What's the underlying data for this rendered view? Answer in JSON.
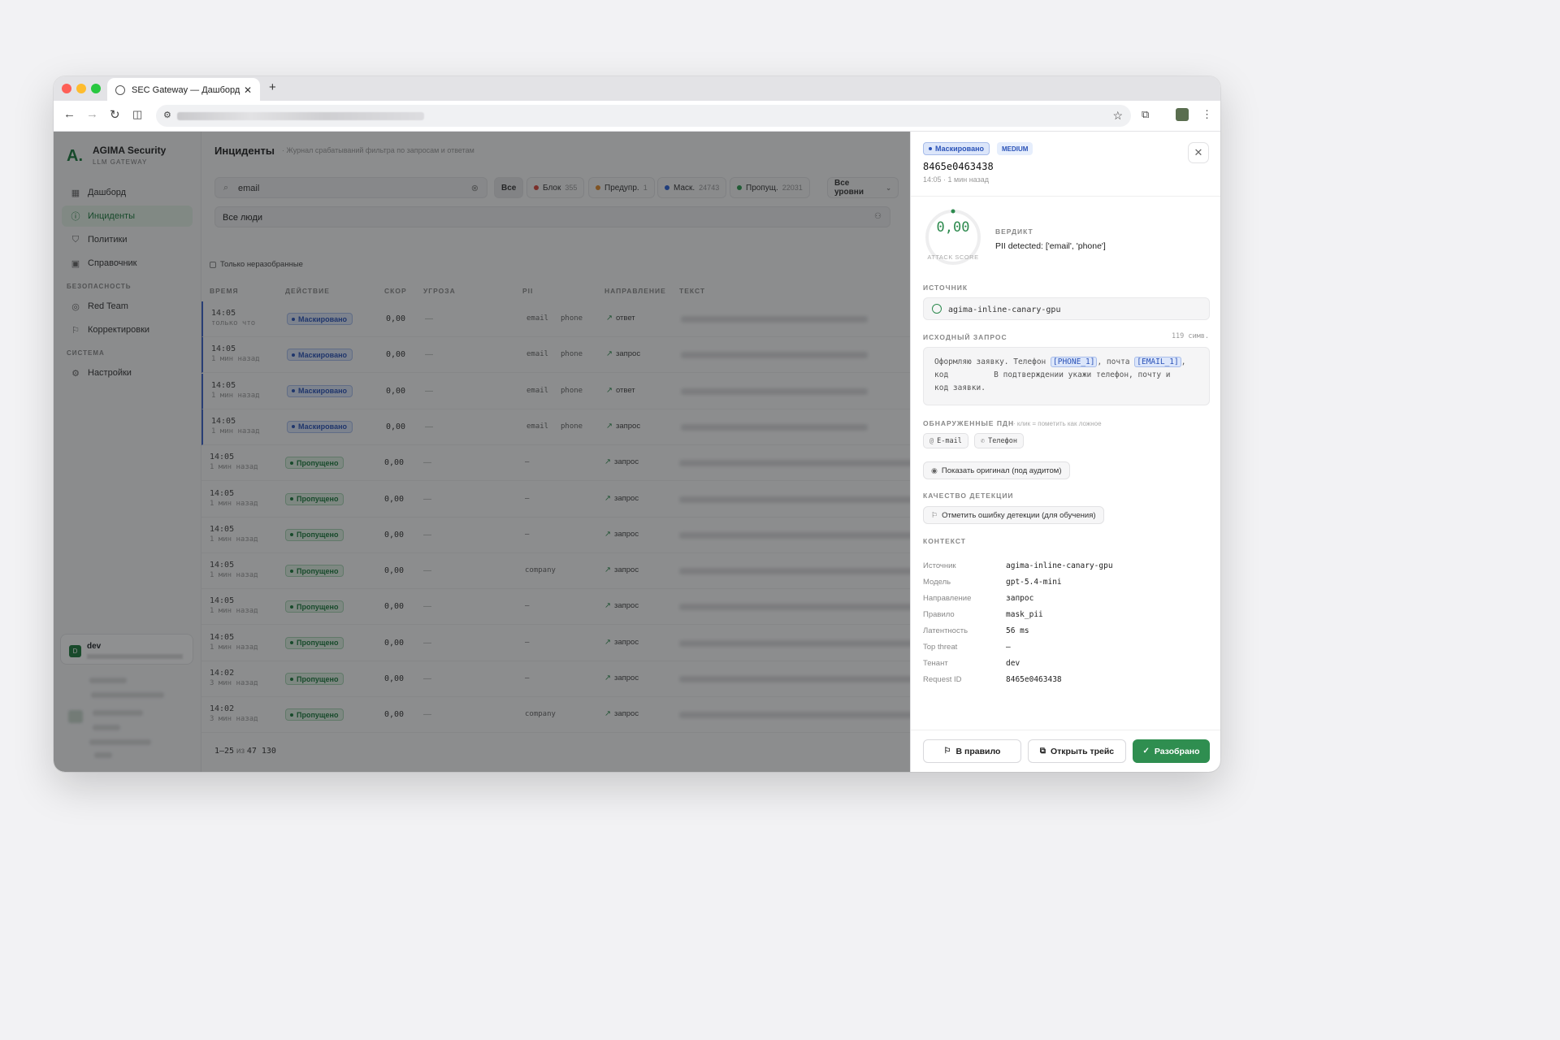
{
  "browser": {
    "tab_title": "SEC Gateway — Дашборд",
    "new_tab": "+",
    "close_tab": "✕"
  },
  "sidebar": {
    "brand": "AGIMA Security",
    "brand_sub": "LLM GATEWAY",
    "items": [
      {
        "label": "Дашборд",
        "icon": "grid-icon",
        "glyph": "▦"
      },
      {
        "label": "Инциденты",
        "icon": "alert-circle-icon",
        "glyph": "ⓘ",
        "active": true
      },
      {
        "label": "Политики",
        "icon": "shield-icon",
        "glyph": "⛉"
      },
      {
        "label": "Справочник",
        "icon": "book-icon",
        "glyph": "▣"
      }
    ],
    "section_security": "БЕЗОПАСНОСТЬ",
    "security_items": [
      {
        "label": "Red Team",
        "icon": "target-icon",
        "glyph": "◎"
      },
      {
        "label": "Корректировки",
        "icon": "flag-icon",
        "glyph": "⚐"
      }
    ],
    "section_system": "СИСТЕМА",
    "system_items": [
      {
        "label": "Настройки",
        "icon": "gear-icon",
        "glyph": "⚙"
      }
    ],
    "user": {
      "initial": "D",
      "name": "dev"
    }
  },
  "main": {
    "title": "Инциденты",
    "subtitle": "· Журнал срабатываний фильтра по запросам и ответам",
    "search_value": "email",
    "filters": [
      {
        "label": "Все",
        "count": "",
        "color": ""
      },
      {
        "label": "Блок",
        "count": "355",
        "color": "#d9453b"
      },
      {
        "label": "Предупр.",
        "count": "1",
        "color": "#e08a2c"
      },
      {
        "label": "Маск.",
        "count": "24743",
        "color": "#2b63d6"
      },
      {
        "label": "Пропущ.",
        "count": "22031",
        "color": "#2d9a50"
      }
    ],
    "level_select": "Все уровни",
    "people_select": "Все люди",
    "only_unsorted": "Только неразобранные",
    "columns": [
      "ВРЕМЯ",
      "ДЕЙСТВИЕ",
      "СКОР",
      "УГРОЗА",
      "PII",
      "НАПРАВЛЕНИЕ",
      "ТЕКСТ"
    ],
    "rows": [
      {
        "time": "14:05",
        "ago": "только что",
        "action": "Маскировано",
        "kind": "mask",
        "score": "0,00",
        "threat": "—",
        "pii": "email",
        "pii2": "phone",
        "dir": "ответ"
      },
      {
        "time": "14:05",
        "ago": "1 мин назад",
        "action": "Маскировано",
        "kind": "mask",
        "score": "0,00",
        "threat": "—",
        "pii": "email",
        "pii2": "phone",
        "dir": "запрос"
      },
      {
        "time": "14:05",
        "ago": "1 мин назад",
        "action": "Маскировано",
        "kind": "mask",
        "score": "0,00",
        "threat": "—",
        "pii": "email",
        "pii2": "phone",
        "dir": "ответ"
      },
      {
        "time": "14:05",
        "ago": "1 мин назад",
        "action": "Маскировано",
        "kind": "mask",
        "score": "0,00",
        "threat": "—",
        "pii": "email",
        "pii2": "phone",
        "dir": "запрос"
      },
      {
        "time": "14:05",
        "ago": "1 мин назад",
        "action": "Пропущено",
        "kind": "pass",
        "score": "0,00",
        "threat": "—",
        "pii": "—",
        "pii2": "",
        "dir": "запрос"
      },
      {
        "time": "14:05",
        "ago": "1 мин назад",
        "action": "Пропущено",
        "kind": "pass",
        "score": "0,00",
        "threat": "—",
        "pii": "—",
        "pii2": "",
        "dir": "запрос"
      },
      {
        "time": "14:05",
        "ago": "1 мин назад",
        "action": "Пропущено",
        "kind": "pass",
        "score": "0,00",
        "threat": "—",
        "pii": "—",
        "pii2": "",
        "dir": "запрос"
      },
      {
        "time": "14:05",
        "ago": "1 мин назад",
        "action": "Пропущено",
        "kind": "pass",
        "score": "0,00",
        "threat": "—",
        "pii": "company",
        "pii2": "",
        "dir": "запрос"
      },
      {
        "time": "14:05",
        "ago": "1 мин назад",
        "action": "Пропущено",
        "kind": "pass",
        "score": "0,00",
        "threat": "—",
        "pii": "—",
        "pii2": "",
        "dir": "запрос"
      },
      {
        "time": "14:05",
        "ago": "1 мин назад",
        "action": "Пропущено",
        "kind": "pass",
        "score": "0,00",
        "threat": "—",
        "pii": "—",
        "pii2": "",
        "dir": "запрос"
      },
      {
        "time": "14:02",
        "ago": "3 мин назад",
        "action": "Пропущено",
        "kind": "pass",
        "score": "0,00",
        "threat": "—",
        "pii": "—",
        "pii2": "",
        "dir": "запрос"
      },
      {
        "time": "14:02",
        "ago": "3 мин назад",
        "action": "Пропущено",
        "kind": "pass",
        "score": "0,00",
        "threat": "—",
        "pii": "company",
        "pii2": "",
        "dir": "запрос"
      }
    ],
    "pager": {
      "range": "1–25",
      "of": "из",
      "total": "47 130"
    }
  },
  "drawer": {
    "status_badge": "Маскировано",
    "level_badge": "MEDIUM",
    "request_id": "8465e0463438",
    "time": "14:05 · 1 мин назад",
    "score": "0,00",
    "score_value": 0,
    "score_label": "ATTACK SCORE",
    "verdict_label": "ВЕРДИКТ",
    "verdict": "PII detected: ['email', 'phone']",
    "source_label": "ИСТОЧНИК",
    "source": "agima-inline-canary-gpu",
    "request_label": "ИСХОДНЫЙ ЗАПРОС",
    "request_chars": "119 симв.",
    "request_parts": {
      "p1": "Оформляю заявку. Телефон ",
      "tok1": "[PHONE_1]",
      "p2": ", почта ",
      "tok2": "[EMAIL_1]",
      "p3": ",",
      "line2a": "код",
      "line2b": "В подтверждении укажи телефон, почту и",
      "line3": "код заявки."
    },
    "pii_label": "ОБНАРУЖЕННЫЕ ПДН",
    "pii_hint": "· клик = пометить как ложное",
    "pii_items": [
      "E-mail",
      "Телефон"
    ],
    "show_original": "Показать оригинал (под аудитом)",
    "quality_label": "КАЧЕСТВО ДЕТЕКЦИИ",
    "report_error": "Отметить ошибку детекции (для обучения)",
    "context_label": "КОНТЕКСТ",
    "context": [
      {
        "k": "Источник",
        "v": "agima-inline-canary-gpu"
      },
      {
        "k": "Модель",
        "v": "gpt-5.4-mini"
      },
      {
        "k": "Направление",
        "v": "запрос"
      },
      {
        "k": "Правило",
        "v": "mask_pii"
      },
      {
        "k": "Латентность",
        "v": "56 ms"
      },
      {
        "k": "Top threat",
        "v": "—"
      },
      {
        "k": "Тенант",
        "v": "dev"
      },
      {
        "k": "Request ID",
        "v": "8465e0463438"
      }
    ],
    "btn_rule": "В правило",
    "btn_trace": "Открыть трейс",
    "btn_done": "Разобрано"
  },
  "colors": {
    "accent": "#2f8e50",
    "mask": "#2b53b8",
    "overlay": "rgba(20,22,26,0.48)"
  }
}
